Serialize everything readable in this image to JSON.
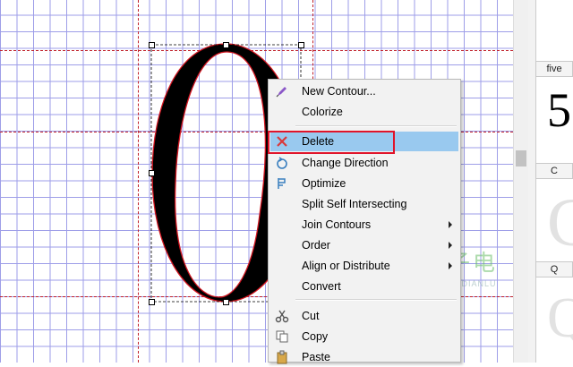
{
  "menu": {
    "items": [
      {
        "label": "New Contour...",
        "icon": "pen-icon"
      },
      {
        "label": "Colorize"
      },
      {
        "label": "Delete",
        "icon": "delete-x-icon",
        "highlighted": true
      },
      {
        "label": "Change Direction",
        "icon": "change-direction-icon"
      },
      {
        "label": "Optimize",
        "icon": "optimize-icon"
      },
      {
        "label": "Split Self Intersecting"
      },
      {
        "label": "Join Contours",
        "submenu": true
      },
      {
        "label": "Order",
        "submenu": true
      },
      {
        "label": "Align or Distribute",
        "submenu": true
      },
      {
        "label": "Convert"
      },
      {
        "label": "Cut",
        "icon": "scissors-icon"
      },
      {
        "label": "Copy",
        "icon": "copy-icon"
      },
      {
        "label": "Paste",
        "icon": "paste-icon"
      }
    ],
    "highlight_color": "#99c9ef",
    "emphasis_box_color": "#e0142a"
  },
  "glyph_panel": {
    "cells": [
      {
        "label": "five",
        "glyph": "5"
      },
      {
        "label": "C",
        "glyph": "C"
      },
      {
        "label": "Q",
        "glyph": "Q"
      }
    ]
  },
  "watermark": {
    "chinese": "电子电路",
    "pinyin": "DIANZIDIANLU"
  },
  "colors": {
    "grid": "#9e9ee8",
    "guides": "#c0202a",
    "outline": "#d0151f",
    "glyph_fill": "#000000"
  }
}
